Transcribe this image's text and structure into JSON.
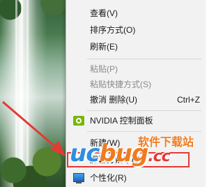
{
  "menu": {
    "items": [
      {
        "label": "查看(V)"
      },
      {
        "label": "排序方式(O)"
      },
      {
        "label": "刷新(E)"
      },
      {
        "label": "粘贴(P)"
      },
      {
        "label": "粘贴快捷方式(S)"
      },
      {
        "label": "撤消 删除(U)",
        "shortcut": "Ctrl+Z"
      },
      {
        "label": "NVIDIA 控制面板"
      },
      {
        "label": "新建(W)"
      },
      {
        "label": "屏幕分辨率(C)"
      },
      {
        "label": "个性化(R)"
      }
    ],
    "highlighted_item": "屏幕分辨率(C)"
  },
  "watermark": {
    "main_blue": "uc",
    "main_orange": "bug",
    "main_red": ".cc",
    "sub": "软件下载站"
  },
  "colors": {
    "menu_background": "#f2f2f2",
    "highlight_border": "#e53935",
    "arrow": "#e53935",
    "nvidia": "#76b900",
    "watermark_blue": "#2d8fe0",
    "watermark_orange": "#f07b1f"
  }
}
